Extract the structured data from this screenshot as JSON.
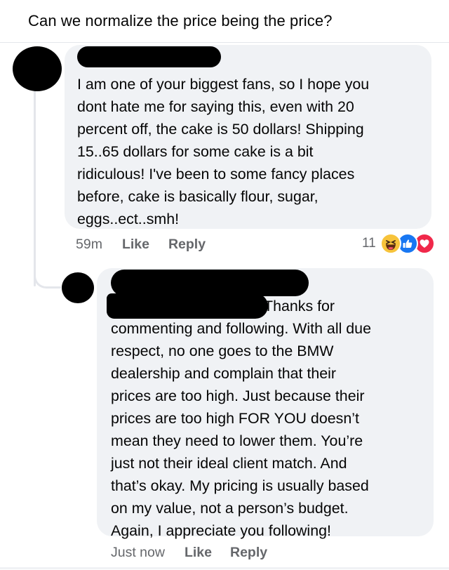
{
  "post": {
    "title": "Can we normalize the price being the price?"
  },
  "comments": [
    {
      "text": "I am one of your biggest fans, so I hope you\ndont hate me for saying this, even with 20\npercent off, the cake is 50 dollars! Shipping\n15..65 dollars for some cake is a bit\nridiculous! I've been to some fancy places\nbefore, cake is basically flour, sugar,\neggs..ect..smh!",
      "time": "59m",
      "like_label": "Like",
      "reply_label": "Reply",
      "reaction_count": "11",
      "reaction_icons": [
        "haha-icon",
        "like-icon",
        "love-icon"
      ]
    },
    {
      "text": "Thanks for\ncommenting and following. With all due\nrespect, no one goes to the BMW\ndealership and complain that their\nprices are too high. Just because their\nprices are too high FOR YOU doesn’t\nmean they need to lower them. You’re\njust not their ideal client match. And\nthat’s okay. My pricing is usually based\non my value, not a person’s budget.\nAgain, I appreciate you following!",
      "time": "Just now",
      "like_label": "Like",
      "reply_label": "Reply"
    }
  ],
  "colors": {
    "bubble": "#f0f2f5",
    "meta_text": "#65676b",
    "like_blue": "#1877f2",
    "love_red": "#f0284a",
    "haha_yellow": "#f7c33b",
    "redaction": "#000000"
  }
}
